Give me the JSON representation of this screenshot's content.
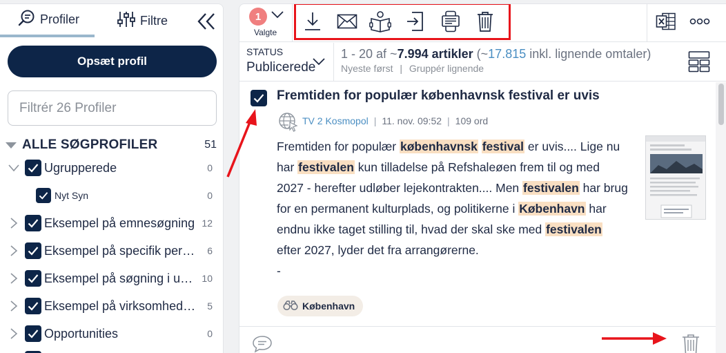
{
  "left_panel": {
    "tabs": [
      {
        "label": "Profiler",
        "icon": "search-chat-icon",
        "active": true
      },
      {
        "label": "Filtre",
        "icon": "sliders-icon",
        "active": false
      }
    ],
    "collapse_icon": "double-chevron-left-icon",
    "setup_button": "Opsæt profil",
    "filter_placeholder": "Filtrér 26 Profiler",
    "all_profiles": {
      "label": "ALLE SØGPROFILER",
      "count": "51"
    },
    "items": [
      {
        "label": "Ugrupperede",
        "count": "0",
        "expanded": true,
        "level": 0
      },
      {
        "label": "Nyt Syn",
        "count": "0",
        "level": 1
      },
      {
        "label": "Eksempel på emnesøgning",
        "count": "12",
        "level": 0
      },
      {
        "label": "Eksempel på specifik personsøgning",
        "count": "6",
        "level": 0
      },
      {
        "label": "Eksempel på søgning i udeladte",
        "count": "10",
        "level": 0
      },
      {
        "label": "Eksempel på virksomhedssøgning",
        "count": "5",
        "level": 0
      },
      {
        "label": "Opportunities",
        "count": "0",
        "level": 0
      }
    ],
    "accent_color": "#0d2548"
  },
  "toolbar": {
    "selected_count": "1",
    "selected_label": "Valgte",
    "actions": [
      "download-icon",
      "mail-icon",
      "reading-book-icon",
      "export-icon",
      "devices-icon",
      "trash-icon"
    ],
    "right_actions": [
      "excel-icon",
      "more-icon"
    ],
    "highlight_color": "#e8141b"
  },
  "status": {
    "label": "STATUS",
    "value": "Publicerede",
    "count_prefix": "1 - 20 af ~",
    "count_bold": "7.994 artikler",
    "count_paren_open": " (~",
    "count_similar": "17.815",
    "count_suffix": " inkl. lignende omtaler)",
    "sort": "Nyeste først",
    "sort_sep": "|",
    "group": "Gruppér lignende"
  },
  "article": {
    "title": "Fremtiden for populær københavnsk festival er uvis",
    "source": "TV 2 Kosmopol",
    "date": "11. nov. 09:52",
    "words": "109 ord",
    "body": [
      {
        "t": "Fremtiden for populær "
      },
      {
        "t": "københavnsk",
        "hl": true
      },
      {
        "t": " "
      },
      {
        "t": "festival",
        "hl": true
      },
      {
        "t": " er uvis.... Lige nu har "
      },
      {
        "t": "festivalen",
        "hl": true
      },
      {
        "t": " kun tilladelse på Refshaleøen frem til og med 2027 - herefter udløber lejekontrakten.... Men "
      },
      {
        "t": "festivalen",
        "hl": true
      },
      {
        "t": " har brug for en permanent kulturplads, og politikerne i "
      },
      {
        "t": "København",
        "hl": true
      },
      {
        "t": " har endnu ikke taget stilling til, hvad der skal ske med "
      },
      {
        "t": "festivalen",
        "hl": true
      },
      {
        "t": " efter 2027, lyder det fra arrangørerne."
      }
    ],
    "trailing": "-",
    "tag": "København",
    "tag_icon": "binoculars-icon",
    "highlight_color": "#f9dfc2"
  },
  "footer": {
    "comment_icon": "comment-icon",
    "trash_icon": "trash-icon"
  }
}
